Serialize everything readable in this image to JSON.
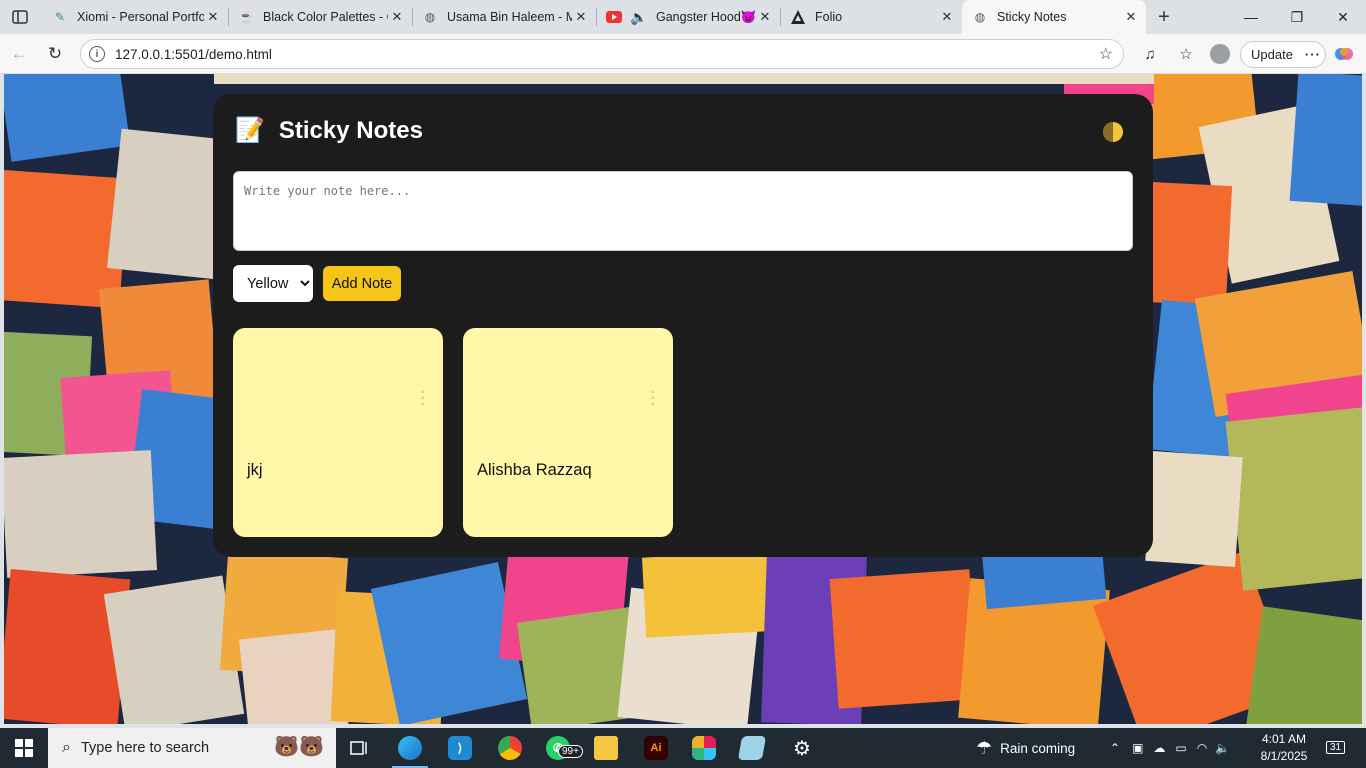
{
  "browser": {
    "tabs": [
      {
        "title": "Xiomi - Personal Portfo",
        "favicon": "leaf-icon",
        "active": false
      },
      {
        "title": "Black Color Palettes - C",
        "favicon": "palette-icon",
        "active": false
      },
      {
        "title": "Usama Bin Haleem - M",
        "favicon": "globe-icon",
        "active": false
      },
      {
        "title": "Gangster Hood👿",
        "favicon": "youtube-icon",
        "active": false
      },
      {
        "title": "Folio",
        "favicon": "angular-icon",
        "active": false
      },
      {
        "title": "Sticky Notes",
        "favicon": "globe-icon",
        "active": true
      }
    ],
    "url": "127.0.0.1:5501/demo.html",
    "update_label": "Update"
  },
  "app": {
    "emoji": "📝",
    "title": "Sticky Notes",
    "note_placeholder": "Write your note here...",
    "note_value": "",
    "color_selected": "Yellow",
    "color_options": [
      "Yellow"
    ],
    "add_label": "Add Note",
    "accent_color": "#f5c518",
    "note_color": "#fff8a8",
    "notes": [
      {
        "text": "jkj"
      },
      {
        "text": "Alishba Razzaq"
      }
    ]
  },
  "taskbar": {
    "search_placeholder": "Type here to search",
    "whatsapp_badge": "99+",
    "weather": "Rain coming",
    "time": "4:01 AM",
    "date": "8/1/2025",
    "notification_count": "31"
  }
}
